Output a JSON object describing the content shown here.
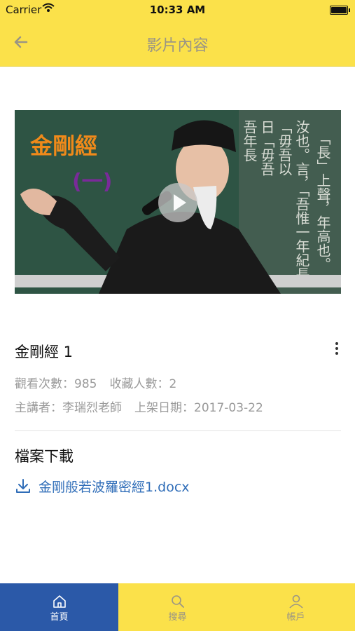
{
  "status": {
    "carrier": "Carrier",
    "time": "10:33 AM"
  },
  "nav": {
    "title": "影片內容"
  },
  "video": {
    "thumbnail_title": "金剛經",
    "thumbnail_subtitle": "(一)",
    "blackboard_text": [
      "「長」上聲，年高也。",
      "汝也。言，「吾惟一年紀長",
      "「毋吾以",
      "日「毋吾",
      "吾年長"
    ]
  },
  "detail": {
    "title": "金剛經 1",
    "views": "觀看次數：985",
    "favorites": "收藏人數：2",
    "speaker": "主講者：李瑞烈老師",
    "date": "上架日期：2017-03-22"
  },
  "files": {
    "section_title": "檔案下載",
    "items": [
      {
        "name": "金剛般若波羅密經1.docx"
      }
    ]
  },
  "tabs": [
    {
      "label": "首頁",
      "icon": "home-icon",
      "active": true
    },
    {
      "label": "搜尋",
      "icon": "search-icon",
      "active": false
    },
    {
      "label": "帳戶",
      "icon": "account-icon",
      "active": false
    }
  ],
  "colors": {
    "accent": "#fbe14a",
    "active_tab": "#2b59a8",
    "link": "#2f6db8"
  }
}
